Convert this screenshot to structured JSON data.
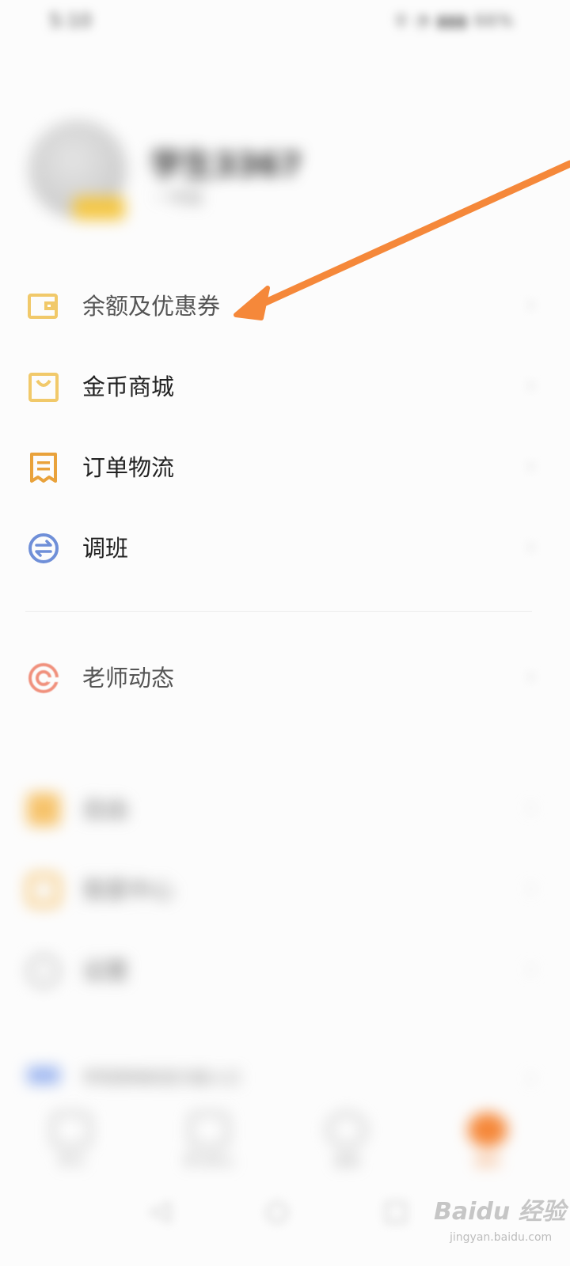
{
  "status_bar": {
    "time": "5:10",
    "icons": "⚲ ◔ ▮▮▮ 66%"
  },
  "profile": {
    "username": "学生3367",
    "subtitle": "一年级"
  },
  "menu": {
    "balance_coupons": "余额及优惠券",
    "coin_mall": "金币商城",
    "orders_logistics": "订单物流",
    "change_class": "调班",
    "teacher_updates": "老师动态",
    "blurred_item_1": "自由",
    "blurred_item_2": "我爱中心",
    "blurred_item_3": "设置",
    "blurred_item_4": "学而思网校官方版入口"
  },
  "bottom_tabs": [
    "学习",
    "学习中心",
    "发现",
    "我的"
  ],
  "chevron": "›",
  "watermark": {
    "main": "Baidu 经验",
    "sub": "jingyan.baidu.com"
  },
  "colors": {
    "accent_orange": "#f5883a",
    "icon_yellow": "#f1c96a",
    "icon_orange_dark": "#e9a23b",
    "icon_blue": "#6f8fd8",
    "icon_red": "#f0907c"
  }
}
